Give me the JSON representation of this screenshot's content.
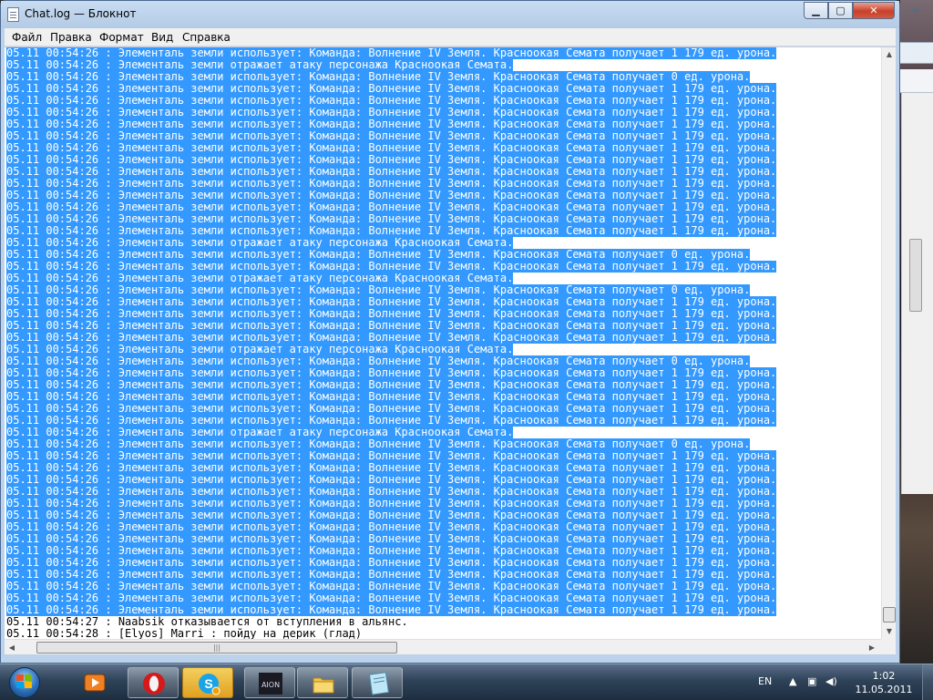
{
  "window": {
    "title": "Chat.log — Блокнот",
    "controls": {
      "minimize": "▁",
      "maximize": "▢",
      "close": "✕"
    }
  },
  "menu": [
    "Файл",
    "Правка",
    "Формат",
    "Вид",
    "Справка"
  ],
  "editor": {
    "lines": [
      {
        "text": "05.11 00:54:26 : Элементаль земли использует: Команда: Волнение IV Земля. Красноокая Семата получает 1 179 ед. урона.",
        "selected": true
      },
      {
        "text": "05.11 00:54:26 : Элементаль земли отражает атаку персонажа Красноокая Семата.",
        "selected": true
      },
      {
        "text": "05.11 00:54:26 : Элементаль земли использует: Команда: Волнение IV Земля. Красноокая Семата получает 0 ед. урона.",
        "selected": true
      },
      {
        "text": "05.11 00:54:26 : Элементаль земли использует: Команда: Волнение IV Земля. Красноокая Семата получает 1 179 ед. урона.",
        "selected": true
      },
      {
        "text": "05.11 00:54:26 : Элементаль земли использует: Команда: Волнение IV Земля. Красноокая Семата получает 1 179 ед. урона.",
        "selected": true
      },
      {
        "text": "05.11 00:54:26 : Элементаль земли использует: Команда: Волнение IV Земля. Красноокая Семата получает 1 179 ед. урона.",
        "selected": true
      },
      {
        "text": "05.11 00:54:26 : Элементаль земли использует: Команда: Волнение IV Земля. Красноокая Семата получает 1 179 ед. урона.",
        "selected": true
      },
      {
        "text": "05.11 00:54:26 : Элементаль земли использует: Команда: Волнение IV Земля. Красноокая Семата получает 1 179 ед. урона.",
        "selected": true
      },
      {
        "text": "05.11 00:54:26 : Элементаль земли использует: Команда: Волнение IV Земля. Красноокая Семата получает 1 179 ед. урона.",
        "selected": true
      },
      {
        "text": "05.11 00:54:26 : Элементаль земли использует: Команда: Волнение IV Земля. Красноокая Семата получает 1 179 ед. урона.",
        "selected": true
      },
      {
        "text": "05.11 00:54:26 : Элементаль земли использует: Команда: Волнение IV Земля. Красноокая Семата получает 1 179 ед. урона.",
        "selected": true
      },
      {
        "text": "05.11 00:54:26 : Элементаль земли использует: Команда: Волнение IV Земля. Красноокая Семата получает 1 179 ед. урона.",
        "selected": true
      },
      {
        "text": "05.11 00:54:26 : Элементаль земли использует: Команда: Волнение IV Земля. Красноокая Семата получает 1 179 ед. урона.",
        "selected": true
      },
      {
        "text": "05.11 00:54:26 : Элементаль земли использует: Команда: Волнение IV Земля. Красноокая Семата получает 1 179 ед. урона.",
        "selected": true
      },
      {
        "text": "05.11 00:54:26 : Элементаль земли использует: Команда: Волнение IV Земля. Красноокая Семата получает 1 179 ед. урона.",
        "selected": true
      },
      {
        "text": "05.11 00:54:26 : Элементаль земли использует: Команда: Волнение IV Земля. Красноокая Семата получает 1 179 ед. урона.",
        "selected": true
      },
      {
        "text": "05.11 00:54:26 : Элементаль земли отражает атаку персонажа Красноокая Семата.",
        "selected": true
      },
      {
        "text": "05.11 00:54:26 : Элементаль земли использует: Команда: Волнение IV Земля. Красноокая Семата получает 0 ед. урона.",
        "selected": true
      },
      {
        "text": "05.11 00:54:26 : Элементаль земли использует: Команда: Волнение IV Земля. Красноокая Семата получает 1 179 ед. урона.",
        "selected": true
      },
      {
        "text": "05.11 00:54:26 : Элементаль земли отражает атаку персонажа Красноокая Семата.",
        "selected": true
      },
      {
        "text": "05.11 00:54:26 : Элементаль земли использует: Команда: Волнение IV Земля. Красноокая Семата получает 0 ед. урона.",
        "selected": true
      },
      {
        "text": "05.11 00:54:26 : Элементаль земли использует: Команда: Волнение IV Земля. Красноокая Семата получает 1 179 ед. урона.",
        "selected": true
      },
      {
        "text": "05.11 00:54:26 : Элементаль земли использует: Команда: Волнение IV Земля. Красноокая Семата получает 1 179 ед. урона.",
        "selected": true
      },
      {
        "text": "05.11 00:54:26 : Элементаль земли использует: Команда: Волнение IV Земля. Красноокая Семата получает 1 179 ед. урона.",
        "selected": true
      },
      {
        "text": "05.11 00:54:26 : Элементаль земли использует: Команда: Волнение IV Земля. Красноокая Семата получает 1 179 ед. урона.",
        "selected": true
      },
      {
        "text": "05.11 00:54:26 : Элементаль земли отражает атаку персонажа Красноокая Семата.",
        "selected": true
      },
      {
        "text": "05.11 00:54:26 : Элементаль земли использует: Команда: Волнение IV Земля. Красноокая Семата получает 0 ед. урона.",
        "selected": true
      },
      {
        "text": "05.11 00:54:26 : Элементаль земли использует: Команда: Волнение IV Земля. Красноокая Семата получает 1 179 ед. урона.",
        "selected": true
      },
      {
        "text": "05.11 00:54:26 : Элементаль земли использует: Команда: Волнение IV Земля. Красноокая Семата получает 1 179 ед. урона.",
        "selected": true
      },
      {
        "text": "05.11 00:54:26 : Элементаль земли использует: Команда: Волнение IV Земля. Красноокая Семата получает 1 179 ед. урона.",
        "selected": true
      },
      {
        "text": "05.11 00:54:26 : Элементаль земли использует: Команда: Волнение IV Земля. Красноокая Семата получает 1 179 ед. урона.",
        "selected": true
      },
      {
        "text": "05.11 00:54:26 : Элементаль земли использует: Команда: Волнение IV Земля. Красноокая Семата получает 1 179 ед. урона.",
        "selected": true
      },
      {
        "text": "05.11 00:54:26 : Элементаль земли отражает атаку персонажа Красноокая Семата.",
        "selected": true
      },
      {
        "text": "05.11 00:54:26 : Элементаль земли использует: Команда: Волнение IV Земля. Красноокая Семата получает 0 ед. урона.",
        "selected": true
      },
      {
        "text": "05.11 00:54:26 : Элементаль земли использует: Команда: Волнение IV Земля. Красноокая Семата получает 1 179 ед. урона.",
        "selected": true
      },
      {
        "text": "05.11 00:54:26 : Элементаль земли использует: Команда: Волнение IV Земля. Красноокая Семата получает 1 179 ед. урона.",
        "selected": true
      },
      {
        "text": "05.11 00:54:26 : Элементаль земли использует: Команда: Волнение IV Земля. Красноокая Семата получает 1 179 ед. урона.",
        "selected": true
      },
      {
        "text": "05.11 00:54:26 : Элементаль земли использует: Команда: Волнение IV Земля. Красноокая Семата получает 1 179 ед. урона.",
        "selected": true
      },
      {
        "text": "05.11 00:54:26 : Элементаль земли использует: Команда: Волнение IV Земля. Красноокая Семата получает 1 179 ед. урона.",
        "selected": true
      },
      {
        "text": "05.11 00:54:26 : Элементаль земли использует: Команда: Волнение IV Земля. Красноокая Семата получает 1 179 ед. урона.",
        "selected": true
      },
      {
        "text": "05.11 00:54:26 : Элементаль земли использует: Команда: Волнение IV Земля. Красноокая Семата получает 1 179 ед. урона.",
        "selected": true
      },
      {
        "text": "05.11 00:54:26 : Элементаль земли использует: Команда: Волнение IV Земля. Красноокая Семата получает 1 179 ед. урона.",
        "selected": true
      },
      {
        "text": "05.11 00:54:26 : Элементаль земли использует: Команда: Волнение IV Земля. Красноокая Семата получает 1 179 ед. урона.",
        "selected": true
      },
      {
        "text": "05.11 00:54:26 : Элементаль земли использует: Команда: Волнение IV Земля. Красноокая Семата получает 1 179 ед. урона.",
        "selected": true
      },
      {
        "text": "05.11 00:54:26 : Элементаль земли использует: Команда: Волнение IV Земля. Красноокая Семата получает 1 179 ед. урона.",
        "selected": true
      },
      {
        "text": "05.11 00:54:26 : Элементаль земли использует: Команда: Волнение IV Земля. Красноокая Семата получает 1 179 ед. урона.",
        "selected": true
      },
      {
        "text": "05.11 00:54:26 : Элементаль земли использует: Команда: Волнение IV Земля. Красноокая Семата получает 1 179 ед. урона.",
        "selected": true
      },
      {
        "text": "05.11 00:54:26 : Элементаль земли использует: Команда: Волнение IV Земля. Красноокая Семата получает 1 179 ед. урона.",
        "selected": true
      },
      {
        "text": "05.11 00:54:27 : Naabsik отказывается от вступления в альянс.",
        "selected": false
      },
      {
        "text": "05.11 00:54:28 : [Elyos] Marri : пойду на дерик (глад)",
        "selected": false
      }
    ]
  },
  "taskbar": {
    "language": "EN",
    "time": "1:02",
    "date": "11.05.2011",
    "apps": [
      {
        "name": "media-center",
        "icon": "media-player-icon"
      },
      {
        "name": "opera",
        "icon": "opera-icon"
      },
      {
        "name": "skype",
        "icon": "skype-icon"
      },
      {
        "name": "aion",
        "icon": "aion-icon",
        "label": "AION"
      },
      {
        "name": "explorer",
        "icon": "folder-icon"
      },
      {
        "name": "notepad",
        "icon": "notepad-icon"
      }
    ]
  },
  "colors": {
    "selection": "#3399ff",
    "titlebar": "#bcd1ea",
    "taskbar": "#2e4258"
  }
}
